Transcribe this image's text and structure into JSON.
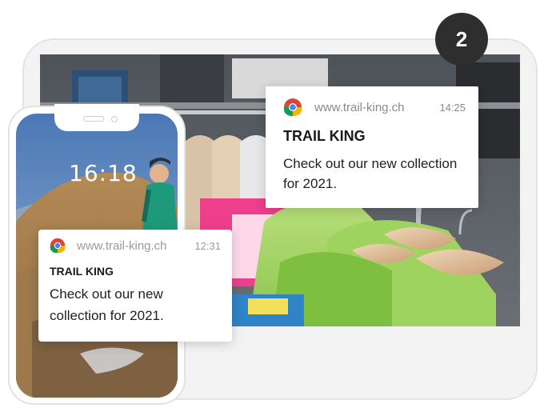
{
  "step": {
    "number": "2"
  },
  "desktop_notification": {
    "url": "www.trail-king.ch",
    "time": "14:25",
    "title": "TRAIL KING",
    "body": "Check out our new collection for 2021.",
    "icon": "chrome-icon"
  },
  "phone": {
    "lock_time": "16:18",
    "notification": {
      "url": "www.trail-king.ch",
      "time": "12:31",
      "title": "TRAIL KING",
      "body": "Check out our new collection for 2021.",
      "icon": "chrome-icon"
    }
  },
  "colors": {
    "badge": "#2e2e2e",
    "frame_border": "#e3e3e3",
    "frame_fill": "#f3f3f3",
    "shirt_green": "#a8d66a",
    "hanger_wood": "#e2c3a0"
  }
}
